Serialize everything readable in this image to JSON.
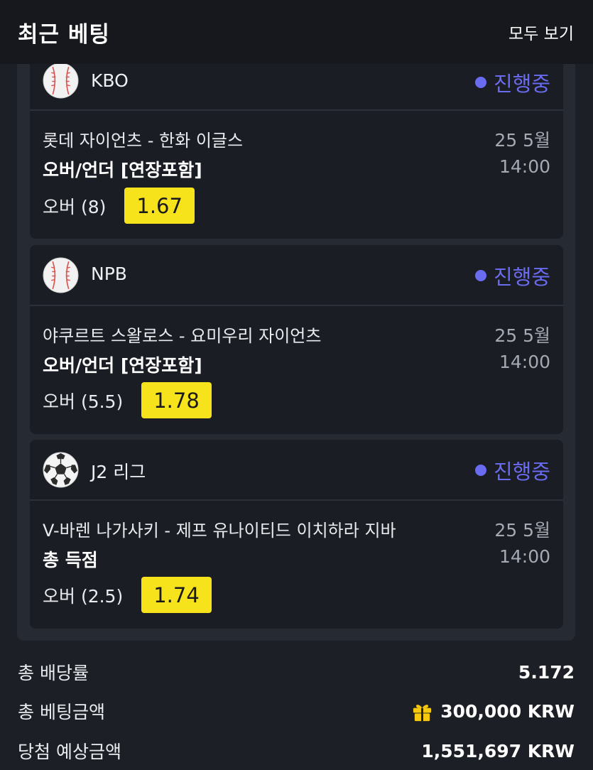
{
  "header": {
    "title": "최근 베팅",
    "view_all": "모두 보기"
  },
  "bets": [
    {
      "league": "KBO",
      "sport_icon": "baseball-icon",
      "status": "진행중",
      "match": "롯데 자이언츠 - 한화 이글스",
      "market": "오버/언더 [연장포함]",
      "date": "25 5월",
      "time": "14:00",
      "pick": "오버 (8)",
      "odds": "1.67"
    },
    {
      "league": "NPB",
      "sport_icon": "baseball-icon",
      "status": "진행중",
      "match": "야쿠르트 스왈로스 - 요미우리 자이언츠",
      "market": "오버/언더 [연장포함]",
      "date": "25 5월",
      "time": "14:00",
      "pick": "오버 (5.5)",
      "odds": "1.78"
    },
    {
      "league": "J2 리그",
      "sport_icon": "soccer-ball-icon",
      "status": "진행중",
      "match": "V-바렌 나가사키 - 제프 유나이티드 이치하라 지바",
      "market": "총 득점",
      "date": "25 5월",
      "time": "14:00",
      "pick": "오버 (2.5)",
      "odds": "1.74"
    }
  ],
  "summary": {
    "total_odds_label": "총 배당률",
    "total_odds_value": "5.172",
    "total_stake_label": "총 베팅금액",
    "total_stake_value": "300,000 KRW",
    "potential_win_label": "당첨 예상금액",
    "potential_win_value": "1,551,697 KRW"
  },
  "colors": {
    "odds_bg": "#f6e31c",
    "status": "#6a6cf0",
    "gift": "#f6c90e"
  }
}
